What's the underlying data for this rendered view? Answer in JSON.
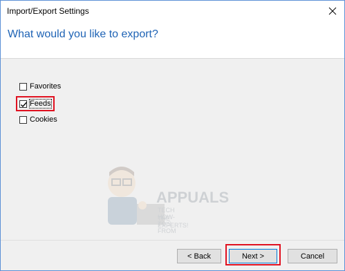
{
  "window": {
    "title": "Import/Export Settings"
  },
  "header": {
    "heading": "What would you like to export?"
  },
  "options": [
    {
      "label": "Favorites",
      "checked": false
    },
    {
      "label": "Feeds",
      "checked": true
    },
    {
      "label": "Cookies",
      "checked": false
    }
  ],
  "footer": {
    "back_label": "< Back",
    "next_label": "Next >",
    "cancel_label": "Cancel"
  },
  "watermark": {
    "brand": "APPUALS",
    "tagline_1": "TECH HOW-TO'S FROM",
    "tagline_2": "THE EXPERTS!"
  },
  "colors": {
    "heading": "#1e63b5",
    "highlight": "#e0101f",
    "accent": "#0078d7"
  }
}
